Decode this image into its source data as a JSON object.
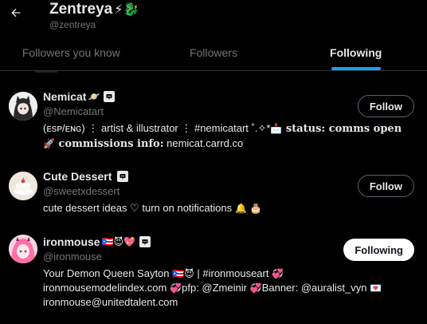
{
  "header": {
    "title": "Zentreya",
    "title_emojis": "⚡🐉",
    "handle": "@zentreya"
  },
  "tabs": [
    {
      "label": "Followers you know",
      "active": false
    },
    {
      "label": "Followers",
      "active": false
    },
    {
      "label": "Following",
      "active": true
    }
  ],
  "colors": {
    "accent": "#1d9bf0",
    "muted": "#71767b",
    "background": "#000000",
    "text": "#e7e9ea"
  },
  "users": [
    {
      "name": "Nemicat",
      "name_emoji": "🪐",
      "badge_icon": "automated-badge-icon",
      "handle": "@Nemicatart",
      "bio_line1_plain": "(ᴇsᴘ/ᴇɴɢ) ⋮ artist & illustrator ⋮ #nemicatart ˚.✧*",
      "bio_line1_emoji": "📩",
      "bio_line1_bold": " status: comms open",
      "bio_line2_emoji": "🚀",
      "bio_line2_bold": " commissions info:",
      "bio_line2_plain": " nemicat.carrd.co",
      "button": "Follow"
    },
    {
      "name": "Cute Dessert",
      "name_emoji": "",
      "badge_icon": "automated-badge-icon",
      "handle": "@sweetxdessert",
      "bio_text": "cute dessert ideas ♡ turn on notifications",
      "bio_emojis": " 🔔 🎂",
      "button": "Follow"
    },
    {
      "name": "ironmouse",
      "name_emoji": "🇵🇷😈💖",
      "badge_icon": "automated-badge-icon",
      "handle": "@ironmouse",
      "bio_line1_plain": "Your Demon Queen Sayton",
      "bio_line1_emoji": " 🇵🇷😈",
      "bio_line1_plain2": " | #ironmouseart",
      "bio_line1_emoji2": " 💞",
      "bio_line2_plain": "ironmousemodelindex.com",
      "bio_line2_emoji": " 💞",
      "bio_line2_plain2": "pfp: @Zmeinir",
      "bio_line2_emoji2": " 💞",
      "bio_line2_plain3": "Banner: @auralist_vyn",
      "bio_line2_emoji3": " 💌",
      "bio_line3_plain": "ironmouse@unitedtalent.com",
      "button": "Following"
    }
  ]
}
